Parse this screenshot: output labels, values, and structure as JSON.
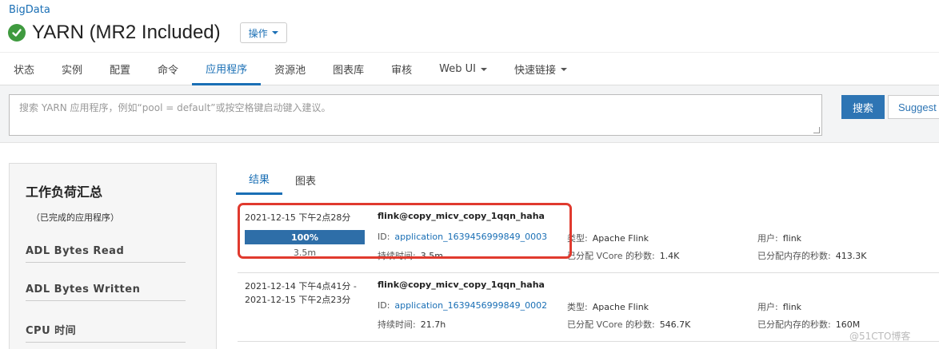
{
  "header": {
    "cluster": "BigData",
    "title": "YARN (MR2 Included)",
    "ops_label": "操作"
  },
  "tabs": [
    {
      "label": "状态"
    },
    {
      "label": "实例"
    },
    {
      "label": "配置"
    },
    {
      "label": "命令"
    },
    {
      "label": "应用程序",
      "active": true
    },
    {
      "label": "资源池"
    },
    {
      "label": "图表库"
    },
    {
      "label": "审核"
    },
    {
      "label": "Web UI",
      "dropdown": true
    },
    {
      "label": "快速链接",
      "dropdown": true
    }
  ],
  "search": {
    "placeholder": "搜索 YARN 应用程序，例如“pool = default”或按空格键启动键入建议。",
    "search_label": "搜索",
    "suggest_label": "Suggest"
  },
  "sidebar": {
    "title": "工作负荷汇总",
    "subtitle": "（已完成的应用程序）",
    "facets": [
      "ADL Bytes Read",
      "ADL Bytes Written",
      "CPU 时间"
    ]
  },
  "result_tabs": [
    {
      "label": "结果",
      "active": true
    },
    {
      "label": "图表"
    }
  ],
  "apps": [
    {
      "time": "2021-12-15 下午2点28分",
      "progress_label": "100%",
      "progress_pct": 100,
      "duration_short": "3.5m",
      "name": "flink@copy_micv_copy_1qqn_haha",
      "id_label": "ID:",
      "id": "application_1639456999849_0003",
      "duration_label": "持续时间:",
      "duration": "3.5m",
      "type_label": "类型:",
      "type": "Apache Flink",
      "vcore_label": "已分配 VCore 的秒数:",
      "vcore": "1.4K",
      "user_label": "用户:",
      "user": "flink",
      "mem_label": "已分配内存的秒数:",
      "mem": "413.3K"
    },
    {
      "time": "2021-12-14 下午4点41分 -",
      "time2": "2021-12-15 下午2点23分",
      "name": "flink@copy_micv_copy_1qqn_haha",
      "id_label": "ID:",
      "id": "application_1639456999849_0002",
      "duration_label": "持续时间:",
      "duration": "21.7h",
      "type_label": "类型:",
      "type": "Apache Flink",
      "vcore_label": "已分配 VCore 的秒数:",
      "vcore": "546.7K",
      "user_label": "用户:",
      "user": "flink",
      "mem_label": "已分配内存的秒数:",
      "mem": "160M"
    }
  ],
  "colors": {
    "accent": "#1a6fb5",
    "highlight": "#e03a2e",
    "status_ok": "#3f9a3f"
  },
  "watermark": "@51CTO博客"
}
